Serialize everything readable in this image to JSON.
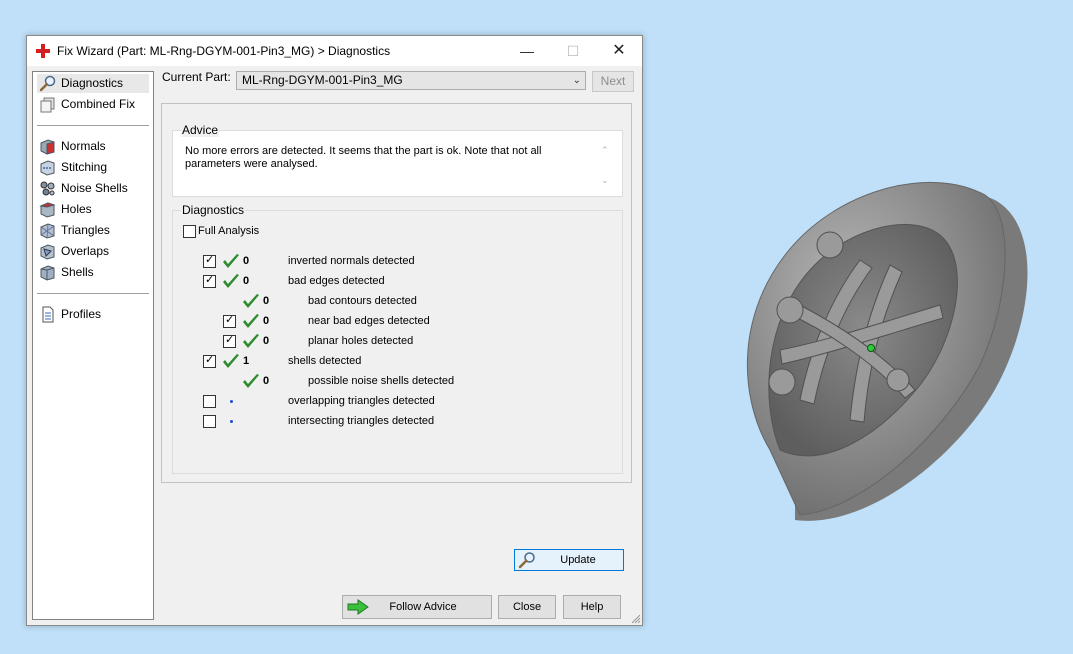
{
  "window": {
    "title": "Fix Wizard (Part: ML-Rng-DGYM-001-Pin3_MG) > Diagnostics",
    "minimize": "—",
    "maximize": "☐",
    "close": "✕"
  },
  "sidebar": {
    "items": [
      {
        "label": "Diagnostics",
        "icon": "magnifier-icon",
        "selected": true
      },
      {
        "label": "Combined Fix",
        "icon": "combined-fix-icon"
      },
      {
        "label": "Normals",
        "icon": "normals-icon"
      },
      {
        "label": "Stitching",
        "icon": "stitching-icon"
      },
      {
        "label": "Noise Shells",
        "icon": "noise-shells-icon"
      },
      {
        "label": "Holes",
        "icon": "holes-icon"
      },
      {
        "label": "Triangles",
        "icon": "triangles-icon"
      },
      {
        "label": "Overlaps",
        "icon": "overlaps-icon"
      },
      {
        "label": "Shells",
        "icon": "shells-icon"
      },
      {
        "label": "Profiles",
        "icon": "profiles-icon"
      }
    ]
  },
  "current_part": {
    "label": "Current Part:",
    "value": "ML-Rng-DGYM-001-Pin3_MG",
    "next_label": "Next"
  },
  "advice": {
    "title": "Advice",
    "text": "No more errors are detected. It seems that the part is ok. Note that not all parameters were analysed."
  },
  "diagnostics": {
    "title": "Diagnostics",
    "full_analysis_label": "Full Analysis",
    "full_analysis_checked": false,
    "rows": [
      {
        "checkbox": true,
        "checked": true,
        "status": "ok",
        "count": "0",
        "text": "inverted normals detected",
        "indent": 0
      },
      {
        "checkbox": true,
        "checked": true,
        "status": "ok",
        "count": "0",
        "text": "bad edges detected",
        "indent": 0
      },
      {
        "checkbox": false,
        "checked": false,
        "status": "ok",
        "count": "0",
        "text": "bad contours detected",
        "indent": 1
      },
      {
        "checkbox": true,
        "checked": true,
        "status": "ok",
        "count": "0",
        "text": "near bad edges detected",
        "indent": 1
      },
      {
        "checkbox": true,
        "checked": true,
        "status": "ok",
        "count": "0",
        "text": "planar holes detected",
        "indent": 1
      },
      {
        "checkbox": true,
        "checked": true,
        "status": "ok",
        "count": "1",
        "text": "shells detected",
        "indent": 0
      },
      {
        "checkbox": false,
        "checked": false,
        "status": "ok",
        "count": "0",
        "text": "possible noise shells detected",
        "indent": 1
      },
      {
        "checkbox": true,
        "checked": false,
        "status": "dot",
        "count": "",
        "text": "overlapping triangles detected",
        "indent": 0
      },
      {
        "checkbox": true,
        "checked": false,
        "status": "dot",
        "count": "",
        "text": "intersecting triangles detected",
        "indent": 0
      }
    ],
    "update_label": "Update"
  },
  "footer": {
    "follow_advice_label": "Follow Advice",
    "close_label": "Close",
    "help_label": "Help"
  },
  "colors": {
    "check_green": "#2e8b2e",
    "dot_blue": "#1a4fd6",
    "accent": "#0078d7",
    "desktop": "#bfe0f8"
  }
}
